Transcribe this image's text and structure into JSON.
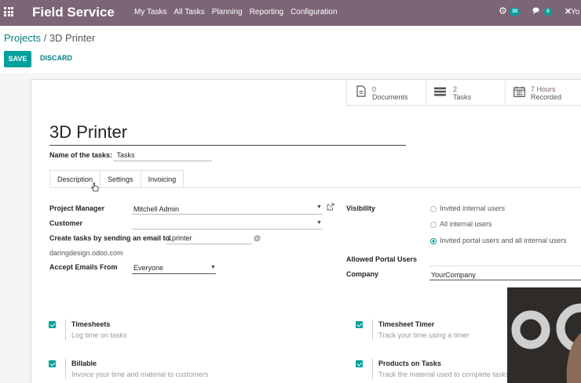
{
  "topbar": {
    "app_title": "Field Service",
    "menu": [
      "My Tasks",
      "All Tasks",
      "Planning",
      "Reporting",
      "Configuration"
    ],
    "activity_count": "30",
    "message_count": "5",
    "user_initial": "Yo"
  },
  "breadcrumb": {
    "parent": "Projects",
    "separator": " / ",
    "current": "3D Printer"
  },
  "buttons": {
    "save": "SAVE",
    "discard": "DISCARD"
  },
  "smart_buttons": [
    {
      "value": "0",
      "label": "Documents",
      "icon": "document-icon"
    },
    {
      "value": "2",
      "label": "Tasks",
      "icon": "tasks-icon"
    },
    {
      "value": "7 Hours",
      "label": "Recorded",
      "icon": "calendar-icon"
    }
  ],
  "project": {
    "name": "3D Printer",
    "tasks_label": "Name of the tasks:",
    "tasks_value": "Tasks"
  },
  "tabs": [
    "Description",
    "Settings",
    "Invoicing"
  ],
  "settings": {
    "project_manager_label": "Project Manager",
    "project_manager_value": "Mitchell Admin",
    "customer_label": "Customer",
    "customer_value": "",
    "email_label": "Create tasks by sending an email to",
    "email_alias": "1printer",
    "email_at": "@",
    "email_domain": "daringdesign.odoo.com",
    "accept_label": "Accept Emails From",
    "accept_value": "Everyone",
    "visibility_label": "Visibility",
    "visibility_options": [
      "Invited internal users",
      "All internal users",
      "Invited portal users and all internal users"
    ],
    "visibility_selected": 2,
    "portal_label": "Allowed Portal Users",
    "company_label": "Company",
    "company_value": "YourCompany"
  },
  "features": [
    {
      "title": "Timesheets",
      "desc": "Log time on tasks",
      "checked": true
    },
    {
      "title": "Timesheet Timer",
      "desc": "Track your time using a timer",
      "checked": true
    },
    {
      "title": "Billable",
      "desc": "Invoice your time and material to customers",
      "checked": true
    },
    {
      "title": "Products on Tasks",
      "desc": "Track the material used to complete tasks",
      "checked": true
    }
  ],
  "colors": {
    "brand": "#7c6576",
    "accent": "#00a09d",
    "link": "#017e84"
  }
}
